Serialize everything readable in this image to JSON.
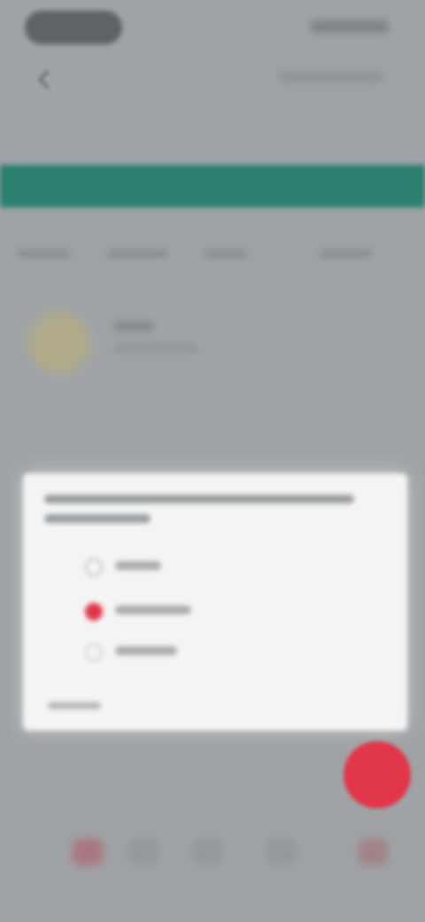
{
  "status_bar": {
    "time_pill": "",
    "icons": ""
  },
  "app_bar": {
    "back_icon": "back-arrow-icon"
  },
  "page": {
    "title": ""
  },
  "dialog": {
    "message": "",
    "options": [
      {
        "label": "",
        "selected": false
      },
      {
        "label": "",
        "selected": true
      },
      {
        "label": "",
        "selected": false
      }
    ],
    "footer": ""
  },
  "fab": {
    "icon": "add-icon",
    "color": "#e2364a"
  },
  "bottom_nav": {
    "items": [
      {
        "icon": "nav-icon-1"
      },
      {
        "icon": "nav-icon-2"
      },
      {
        "icon": "nav-icon-3"
      },
      {
        "icon": "nav-icon-4"
      },
      {
        "icon": "nav-icon-5"
      }
    ]
  },
  "colors": {
    "scrim": "#9fa3a6",
    "teal_band": "#2b7f6e",
    "accent": "#e2364a",
    "dialog_bg": "#f4f4f4"
  }
}
